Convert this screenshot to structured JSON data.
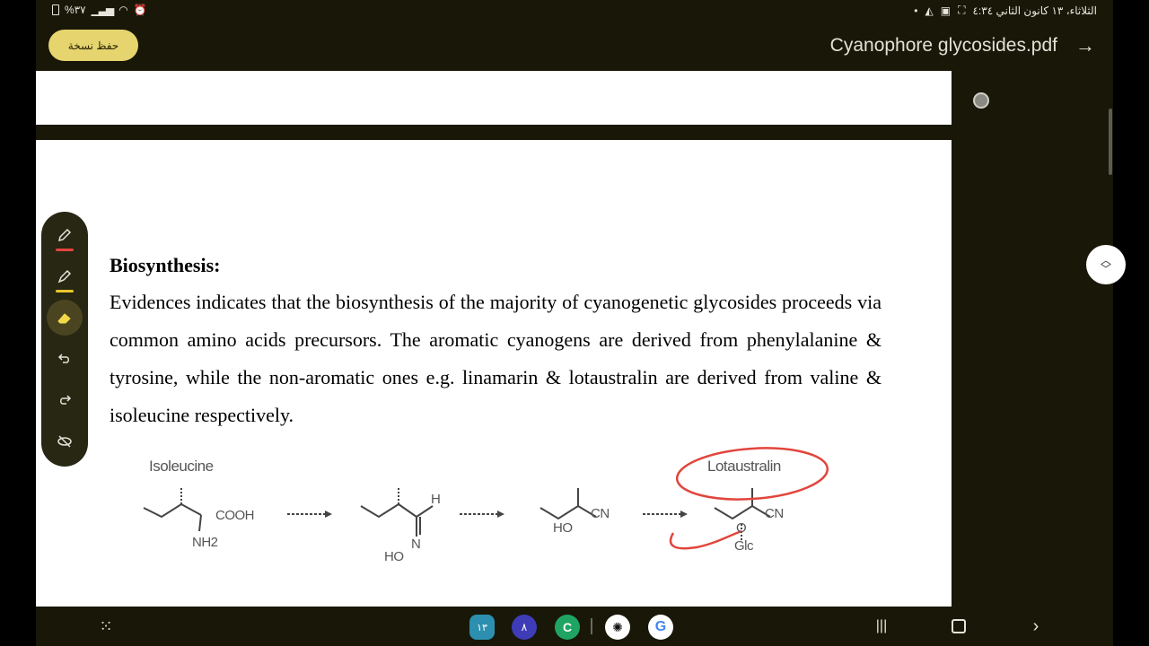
{
  "status_bar": {
    "left_text": "%٣٧",
    "datetime": "الثلاثاء، ١٣ كانون الثاني ٤:٣٤",
    "icons": [
      "battery-icon",
      "signal-icon",
      "wifi-icon",
      "alarm-icon",
      "dot-icon",
      "vpn-icon",
      "screen-record-icon",
      "screenshot-icon"
    ]
  },
  "app_bar": {
    "save_label": "حفظ نسخة",
    "title": "Cyanophore glycosides.pdf",
    "back_icon": "arrow-right-icon"
  },
  "document": {
    "heading": "Biosynthesis:",
    "paragraph": "Evidences indicates that the biosynthesis of the majority of cyanogenetic glycosides proceeds via common amino acids precursors. The aromatic cyanogens are derived from phenylalanine & tyrosine, while the non-aromatic ones e.g. linamarin & lotaustralin are derived from valine & isoleucine respectively.",
    "figure": {
      "start_label": "Isoleucine",
      "end_label": "Lotaustralin",
      "groups": [
        "COOH",
        "NH2",
        "H",
        "N",
        "HO",
        "HO",
        "CN",
        "CN",
        "O",
        "Glc"
      ]
    }
  },
  "annotation_toolbar": {
    "tools": [
      {
        "name": "pen-icon",
        "color": "#e2453c"
      },
      {
        "name": "highlighter-icon",
        "color": "#e8c72a"
      },
      {
        "name": "eraser-icon",
        "color": ""
      },
      {
        "name": "undo-icon",
        "color": ""
      },
      {
        "name": "redo-icon",
        "color": ""
      },
      {
        "name": "hide-annotations-icon",
        "color": ""
      }
    ]
  },
  "nav_bar": {
    "apps": [
      {
        "name": "calendar-app-icon",
        "label": "١٣",
        "color": "#2c8fb0"
      },
      {
        "name": "app-icon-purple",
        "label": "٨",
        "color": "#3f3cb8"
      },
      {
        "name": "phone-app-icon",
        "label": "C",
        "color": "#1fa463"
      },
      {
        "name": "chatgpt-app-icon",
        "label": "",
        "color": "#ffffff"
      },
      {
        "name": "google-app-icon",
        "label": "G",
        "color": "#ffffff"
      }
    ]
  },
  "colors": {
    "accent": "#e6d46e",
    "annotation_red": "#e2453c",
    "background": "#181708"
  }
}
